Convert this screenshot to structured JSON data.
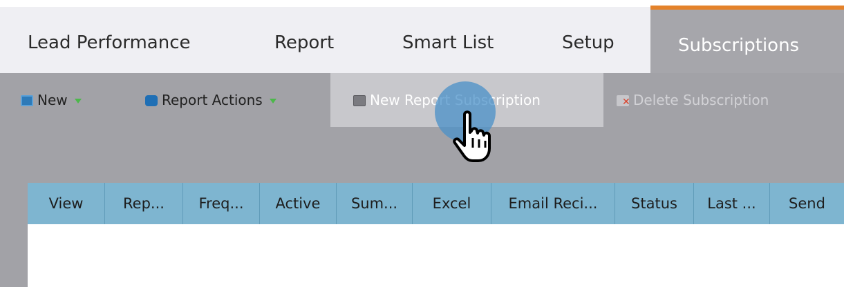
{
  "tabs": [
    {
      "label": "Lead Performance"
    },
    {
      "label": "Report"
    },
    {
      "label": "Smart List"
    },
    {
      "label": "Setup"
    },
    {
      "label": "Subscriptions",
      "active": true
    }
  ],
  "toolbar": {
    "new_label": "New",
    "report_actions_label": "Report Actions",
    "new_subscription_label": "New Report Subscription",
    "delete_subscription_label": "Delete Subscription"
  },
  "grid": {
    "columns": [
      "View",
      "Rep...",
      "Freq...",
      "Active",
      "Sum...",
      "Excel",
      "Email Reci...",
      "Status",
      "Last ...",
      "Send"
    ]
  },
  "colors": {
    "accent": "#e4822a",
    "toolbar_bg": "#a2a2a7",
    "header_bg": "#7eb5d0",
    "click_highlight": "#4a90c8"
  }
}
